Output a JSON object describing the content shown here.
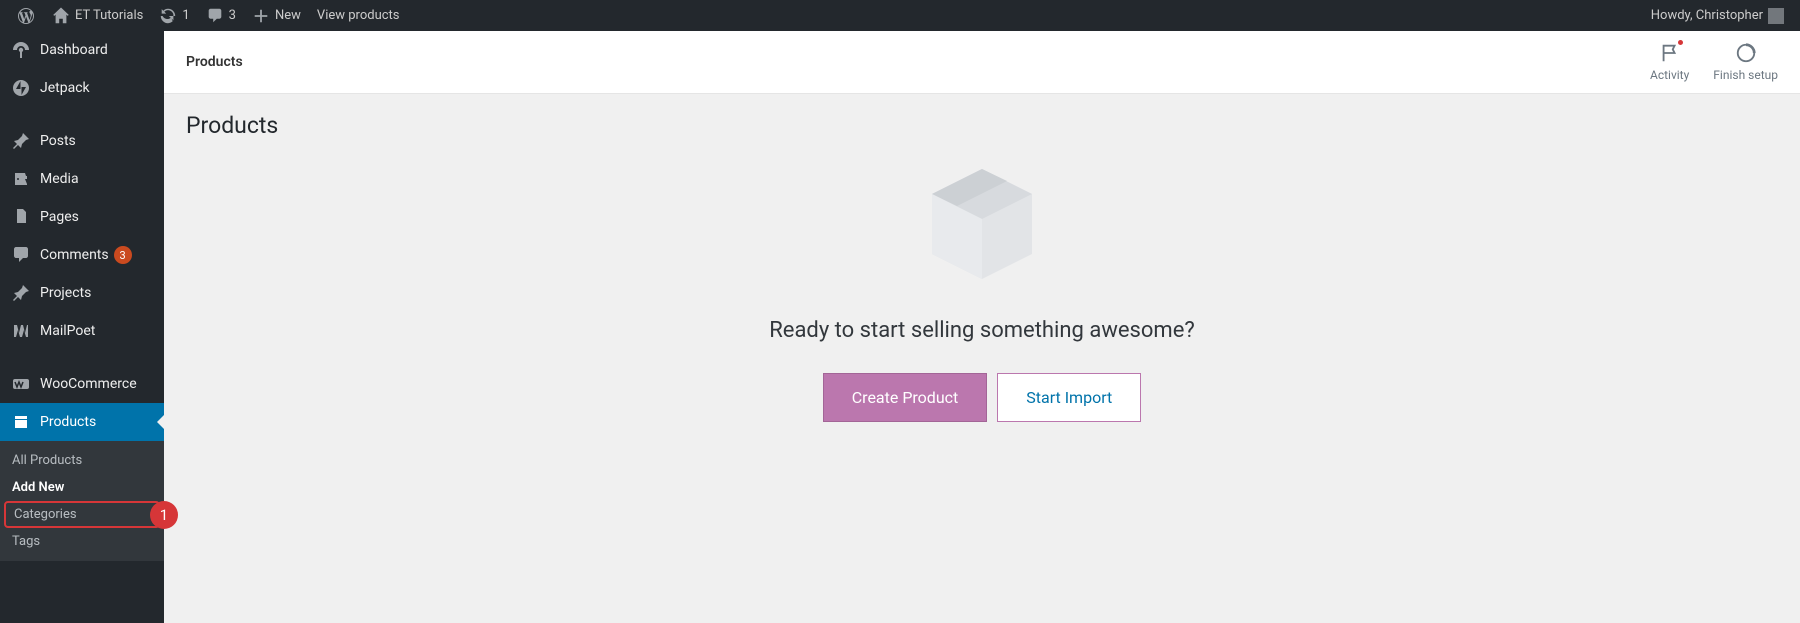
{
  "admin_bar": {
    "site_name": "ET Tutorials",
    "updates_count": "1",
    "comments_count": "3",
    "new_label": "New",
    "view_products_label": "View products",
    "greeting": "Howdy, Christopher"
  },
  "sidebar": {
    "items": [
      {
        "label": "Dashboard",
        "icon": "dashboard"
      },
      {
        "label": "Jetpack",
        "icon": "jetpack"
      },
      {
        "label": "Posts",
        "icon": "pin"
      },
      {
        "label": "Media",
        "icon": "media"
      },
      {
        "label": "Pages",
        "icon": "pages"
      },
      {
        "label": "Comments",
        "icon": "comments",
        "badge": "3"
      },
      {
        "label": "Projects",
        "icon": "pin"
      },
      {
        "label": "MailPoet",
        "icon": "mailpoet"
      },
      {
        "label": "WooCommerce",
        "icon": "woo"
      },
      {
        "label": "Products",
        "icon": "products",
        "current": true
      }
    ],
    "submenu": [
      {
        "label": "All Products"
      },
      {
        "label": "Add New",
        "current": true
      },
      {
        "label": "Categories",
        "highlight": true,
        "annotation": "1"
      },
      {
        "label": "Tags"
      }
    ]
  },
  "header": {
    "breadcrumb": "Products",
    "activity_label": "Activity",
    "finish_setup_label": "Finish setup"
  },
  "page": {
    "title": "Products",
    "empty_heading": "Ready to start selling something awesome?",
    "create_button": "Create Product",
    "import_button": "Start Import"
  }
}
